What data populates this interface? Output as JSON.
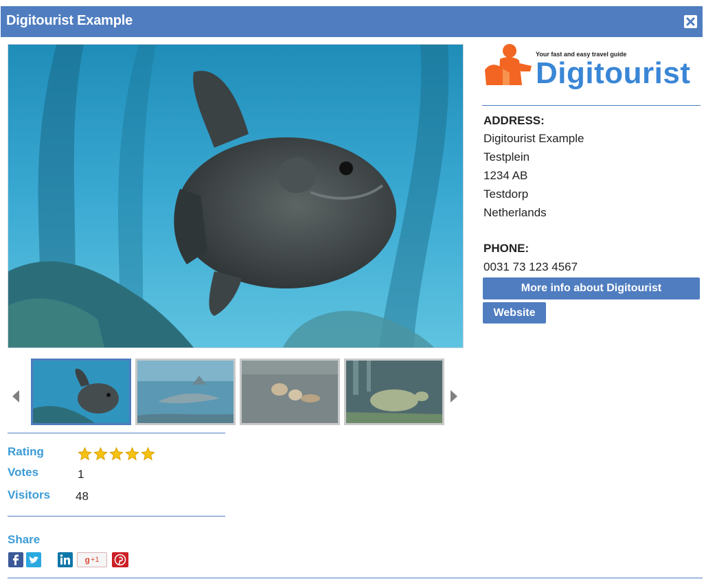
{
  "window": {
    "title": "Digitourist Example"
  },
  "logo": {
    "tagline": "Your fast and easy travel guide",
    "brand": "Digitourist"
  },
  "address": {
    "heading": "ADDRESS:",
    "lines": [
      "Digitourist Example",
      "Testplein",
      "1234 AB",
      "Testdorp",
      "Netherlands"
    ]
  },
  "phone": {
    "heading": "PHONE:",
    "number": "0031 73 123 4567"
  },
  "buttons": {
    "more_info": "More info about Digitourist",
    "website": "Website"
  },
  "gallery": {
    "thumbnails": [
      "sunfish",
      "shark",
      "otters",
      "turtle"
    ],
    "active_index": 0
  },
  "stats": {
    "rating_label": "Rating",
    "rating_value": 5,
    "rating_max": 5,
    "votes_label": "Votes",
    "votes_value": "1",
    "visitors_label": "Visitors",
    "visitors_value": "48"
  },
  "share": {
    "label": "Share",
    "networks": [
      "facebook",
      "twitter",
      "linkedin",
      "google-plus",
      "pinterest"
    ],
    "gplus_text": "+1"
  },
  "colors": {
    "accent": "#4f7dc0",
    "label_blue": "#3b9bd6",
    "star": "#f5c211",
    "logo_orange": "#f26522"
  }
}
